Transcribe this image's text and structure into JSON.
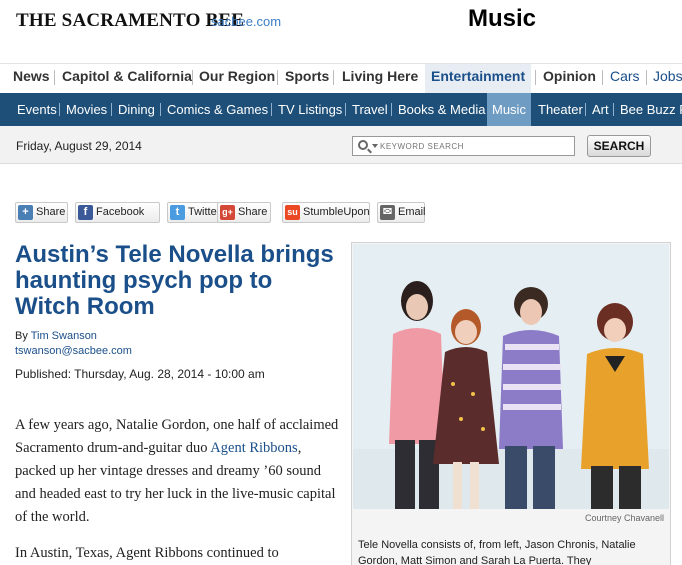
{
  "masthead": {
    "logo": "THE SACRAMENTO BEE",
    "site_link": "sacbee.com",
    "section_title": "Music"
  },
  "nav_primary": [
    "News",
    "Capitol & California",
    "Our Region",
    "Sports",
    "Living Here",
    "Entertainment",
    "Opinion",
    "Cars",
    "Jobs"
  ],
  "nav_primary_active": "Entertainment",
  "nav_secondary": [
    "Events",
    "Movies",
    "Dining",
    "Comics & Games",
    "TV Listings",
    "Travel",
    "Books & Media",
    "Music",
    "Theater",
    "Art",
    "Bee Buzz P"
  ],
  "nav_secondary_active": "Music",
  "date_bar": {
    "date": "Friday, August 29, 2014",
    "search_placeholder": "KEYWORD SEARCH",
    "search_button": "SEARCH"
  },
  "share": [
    {
      "label": "Share",
      "icon": "plus-icon",
      "color": "#4a7fb5"
    },
    {
      "label": "Facebook",
      "icon": "facebook-icon",
      "color": "#3b5998"
    },
    {
      "label": "Twitter",
      "icon": "twitter-icon",
      "color": "#4a9be0"
    },
    {
      "label": "Share",
      "icon": "google-plus-icon",
      "color": "#d34836"
    },
    {
      "label": "StumbleUpon",
      "icon": "stumbleupon-icon",
      "color": "#eb4924"
    },
    {
      "label": "Email",
      "icon": "email-icon",
      "color": "#666666"
    }
  ],
  "article": {
    "headline": "Austin’s Tele Novella brings haunting psych pop to Witch Room",
    "by_prefix": "By",
    "author": "Tim Swanson",
    "email": "tswanson@sacbee.com",
    "published": "Published: Thursday, Aug. 28, 2014 - 10:00 am",
    "para1_before": "A few years ago, Natalie Gordon, one half of acclaimed Sacramento drum-and-guitar duo ",
    "para1_link": "Agent Ribbons",
    "para1_after": ", packed up her vintage dresses and dreamy ’60 sound and headed east to try her luck in the live-music capital of the world.",
    "para2": "In Austin, Texas, Agent Ribbons continued to"
  },
  "photo": {
    "credit": "Courtney Chavanell",
    "caption": "Tele Novella consists of, from left, Jason Chronis, Natalie Gordon, Matt Simon and Sarah La Puerta. They"
  },
  "colors": {
    "nav_dark": "#1d4f78",
    "link_blue": "#1b4f8a",
    "active_tab": "#6f9cc3"
  }
}
